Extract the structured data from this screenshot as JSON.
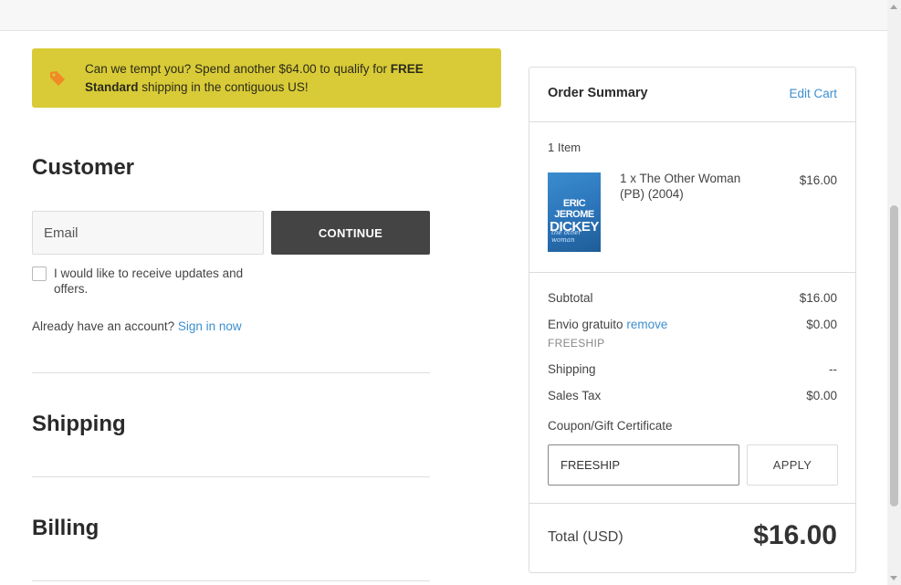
{
  "promo": {
    "icon": "tag-icon",
    "text_before": "Can we tempt you? Spend another $64.00 to qualify for ",
    "text_bold": "FREE Standard",
    "text_after": " shipping in the contiguous US!",
    "color": "#d9cb37",
    "icon_color": "#f08a24"
  },
  "customer": {
    "title": "Customer",
    "email_placeholder": "Email",
    "continue_label": "CONTINUE",
    "newsletter_label": "I would like to receive updates and offers.",
    "already_text": "Already have an account?",
    "sign_in_label": "Sign in now"
  },
  "shipping": {
    "title": "Shipping"
  },
  "billing": {
    "title": "Billing"
  },
  "summary": {
    "title": "Order Summary",
    "edit_cart": "Edit Cart",
    "item_count": "1 Item",
    "item": {
      "cover_author_line1": "ERIC JEROME",
      "cover_author_line2": "DICKEY",
      "cover_subtitle": "the other woman",
      "name": "1 x The Other Woman (PB) (2004)",
      "price": "$16.00"
    },
    "subtotal_label": "Subtotal",
    "subtotal_value": "$16.00",
    "discount_label": "Envio gratuito",
    "discount_remove": "remove",
    "discount_code": "FREESHIP",
    "discount_value": "$0.00",
    "shipping_label": "Shipping",
    "shipping_value": "--",
    "tax_label": "Sales Tax",
    "tax_value": "$0.00",
    "coupon_label": "Coupon/Gift Certificate",
    "coupon_value": "FREESHIP",
    "apply_label": "APPLY",
    "total_label": "Total (USD)",
    "total_value": "$16.00"
  },
  "colors": {
    "link": "#3c8fd0",
    "button_dark": "#444444"
  }
}
